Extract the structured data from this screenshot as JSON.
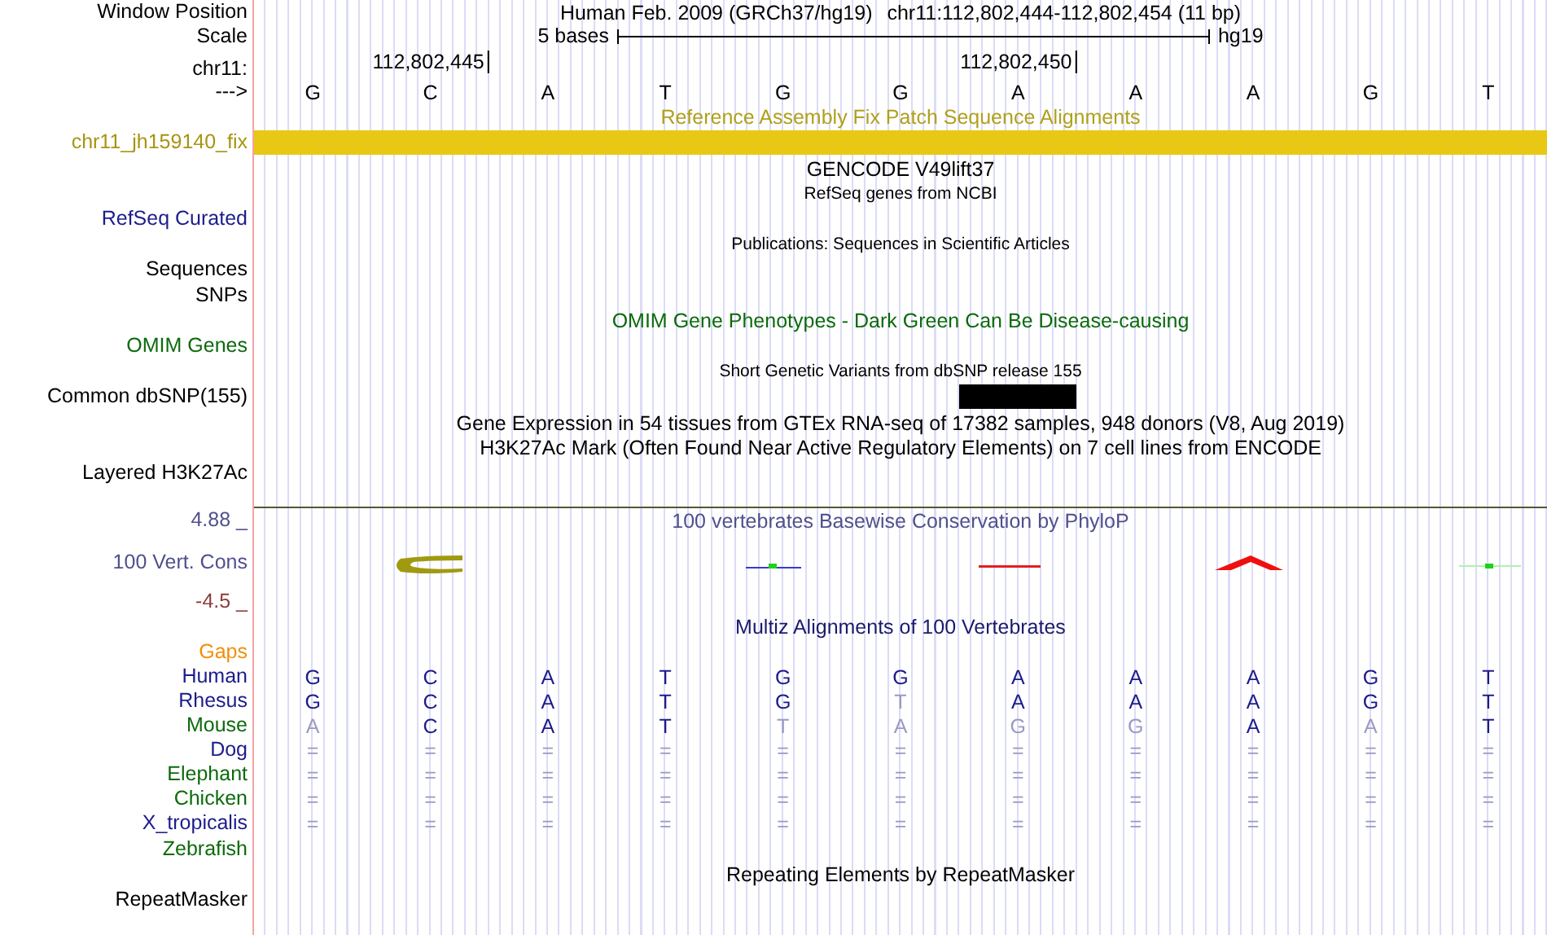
{
  "header": {
    "window_position": {
      "label": "Window Position",
      "assembly": "Human Feb. 2009 (GRCh37/hg19)",
      "range": "chr11:112,802,444-112,802,454 (11 bp)"
    },
    "scale": {
      "label": "Scale",
      "length": "5 bases",
      "assembly": "hg19"
    },
    "ruler": {
      "label": "chr11:",
      "ticks": [
        "112,802,445",
        "112,802,450"
      ]
    },
    "sequence": {
      "label": "--->",
      "bases": [
        "G",
        "C",
        "A",
        "T",
        "G",
        "G",
        "A",
        "A",
        "A",
        "G",
        "T"
      ]
    }
  },
  "tracks": [
    {
      "kind": "title",
      "text": "Reference Assembly Fix Patch Sequence Alignments",
      "color": "#b0a01c"
    },
    {
      "kind": "bar",
      "label": "chr11_jh159140_fix",
      "color": "#a89410"
    },
    {
      "kind": "title",
      "text": "GENCODE V49lift37",
      "color": "#000000"
    },
    {
      "kind": "caption",
      "text": "RefSeq genes from NCBI",
      "color": "#000000"
    },
    {
      "kind": "label",
      "label": "RefSeq Curated",
      "color": "#1c1c8c"
    },
    {
      "kind": "caption",
      "text": "Publications: Sequences in Scientific Articles",
      "color": "#000000"
    },
    {
      "kind": "label",
      "label": "Sequences",
      "color": "#000000"
    },
    {
      "kind": "label",
      "label": "SNPs",
      "color": "#000000"
    },
    {
      "kind": "title",
      "text": "OMIM Gene Phenotypes - Dark Green Can Be Disease-causing",
      "color": "#0c6a0c"
    },
    {
      "kind": "label",
      "label": "OMIM Genes",
      "color": "#0c6a0c"
    },
    {
      "kind": "caption",
      "text": "Short Genetic Variants from dbSNP release 155",
      "color": "#000000"
    },
    {
      "kind": "snp",
      "label": "Common dbSNP(155)",
      "color": "#000000"
    },
    {
      "kind": "title",
      "text": "Gene Expression in 54 tissues from GTEx RNA-seq of 17382 samples, 948 donors (V8, Aug 2019)",
      "color": "#000000"
    },
    {
      "kind": "title",
      "text": "H3K27Ac Mark (Often Found Near Active Regulatory Elements) on 7 cell lines from ENCODE",
      "color": "#000000"
    },
    {
      "kind": "label",
      "label": "Layered H3K27Ac",
      "color": "#000000"
    },
    {
      "kind": "divider"
    },
    {
      "kind": "title",
      "label": "4.88 _",
      "text": "100 vertebrates Basewise Conservation by PhyloP",
      "color": "#50508c"
    },
    {
      "kind": "conservation",
      "label": "100 Vert. Cons",
      "color": "#50508c"
    },
    {
      "kind": "label",
      "label": "-4.5 _",
      "color": "#8c3c3c"
    },
    {
      "kind": "title",
      "text": "Multiz Alignments of 100 Vertebrates",
      "color": "#1a1a6e"
    },
    {
      "kind": "label",
      "label": "Gaps",
      "color": "#f0900c"
    },
    {
      "kind": "alignment",
      "label": "Human",
      "color": "#1c1c8c",
      "bases": [
        {
          "b": "G",
          "dim": false
        },
        {
          "b": "C",
          "dim": false
        },
        {
          "b": "A",
          "dim": false
        },
        {
          "b": "T",
          "dim": false
        },
        {
          "b": "G",
          "dim": false
        },
        {
          "b": "G",
          "dim": false
        },
        {
          "b": "A",
          "dim": false
        },
        {
          "b": "A",
          "dim": false
        },
        {
          "b": "A",
          "dim": false
        },
        {
          "b": "G",
          "dim": false
        },
        {
          "b": "T",
          "dim": false
        }
      ]
    },
    {
      "kind": "alignment",
      "label": "Rhesus",
      "color": "#1c1c8c",
      "bases": [
        {
          "b": "G",
          "dim": false
        },
        {
          "b": "C",
          "dim": false
        },
        {
          "b": "A",
          "dim": false
        },
        {
          "b": "T",
          "dim": false
        },
        {
          "b": "G",
          "dim": false
        },
        {
          "b": "T",
          "dim": true
        },
        {
          "b": "A",
          "dim": false
        },
        {
          "b": "A",
          "dim": false
        },
        {
          "b": "A",
          "dim": false
        },
        {
          "b": "G",
          "dim": false
        },
        {
          "b": "T",
          "dim": false
        }
      ]
    },
    {
      "kind": "alignment",
      "label": "Mouse",
      "color": "#0c6a0c",
      "bases": [
        {
          "b": "A",
          "dim": true
        },
        {
          "b": "C",
          "dim": false
        },
        {
          "b": "A",
          "dim": false
        },
        {
          "b": "T",
          "dim": false
        },
        {
          "b": "T",
          "dim": true
        },
        {
          "b": "A",
          "dim": true
        },
        {
          "b": "G",
          "dim": true
        },
        {
          "b": "G",
          "dim": true
        },
        {
          "b": "A",
          "dim": false
        },
        {
          "b": "A",
          "dim": true
        },
        {
          "b": "T",
          "dim": false
        }
      ]
    },
    {
      "kind": "alignment",
      "label": "Dog",
      "color": "#1c1c8c",
      "bases": [
        {
          "b": "=",
          "dim": true
        },
        {
          "b": "=",
          "dim": true
        },
        {
          "b": "=",
          "dim": true
        },
        {
          "b": "=",
          "dim": true
        },
        {
          "b": "=",
          "dim": true
        },
        {
          "b": "=",
          "dim": true
        },
        {
          "b": "=",
          "dim": true
        },
        {
          "b": "=",
          "dim": true
        },
        {
          "b": "=",
          "dim": true
        },
        {
          "b": "=",
          "dim": true
        },
        {
          "b": "=",
          "dim": true
        }
      ]
    },
    {
      "kind": "alignment",
      "label": "Elephant",
      "color": "#0c6a0c",
      "bases": [
        {
          "b": "=",
          "dim": true
        },
        {
          "b": "=",
          "dim": true
        },
        {
          "b": "=",
          "dim": true
        },
        {
          "b": "=",
          "dim": true
        },
        {
          "b": "=",
          "dim": true
        },
        {
          "b": "=",
          "dim": true
        },
        {
          "b": "=",
          "dim": true
        },
        {
          "b": "=",
          "dim": true
        },
        {
          "b": "=",
          "dim": true
        },
        {
          "b": "=",
          "dim": true
        },
        {
          "b": "=",
          "dim": true
        }
      ]
    },
    {
      "kind": "alignment",
      "label": "Chicken",
      "color": "#0c6a0c",
      "bases": [
        {
          "b": "=",
          "dim": true
        },
        {
          "b": "=",
          "dim": true
        },
        {
          "b": "=",
          "dim": true
        },
        {
          "b": "=",
          "dim": true
        },
        {
          "b": "=",
          "dim": true
        },
        {
          "b": "=",
          "dim": true
        },
        {
          "b": "=",
          "dim": true
        },
        {
          "b": "=",
          "dim": true
        },
        {
          "b": "=",
          "dim": true
        },
        {
          "b": "=",
          "dim": true
        },
        {
          "b": "=",
          "dim": true
        }
      ]
    },
    {
      "kind": "alignment",
      "label": "X_tropicalis",
      "color": "#1c1c8c",
      "bases": [
        {
          "b": "=",
          "dim": true
        },
        {
          "b": "=",
          "dim": true
        },
        {
          "b": "=",
          "dim": true
        },
        {
          "b": "=",
          "dim": true
        },
        {
          "b": "=",
          "dim": true
        },
        {
          "b": "=",
          "dim": true
        },
        {
          "b": "=",
          "dim": true
        },
        {
          "b": "=",
          "dim": true
        },
        {
          "b": "=",
          "dim": true
        },
        {
          "b": "=",
          "dim": true
        },
        {
          "b": "=",
          "dim": true
        }
      ]
    },
    {
      "kind": "label",
      "label": "Zebrafish",
      "color": "#0c6a0c"
    },
    {
      "kind": "title",
      "text": "Repeating Elements by RepeatMasker",
      "color": "#000000"
    },
    {
      "kind": "label",
      "label": "RepeatMasker",
      "color": "#000000"
    }
  ]
}
